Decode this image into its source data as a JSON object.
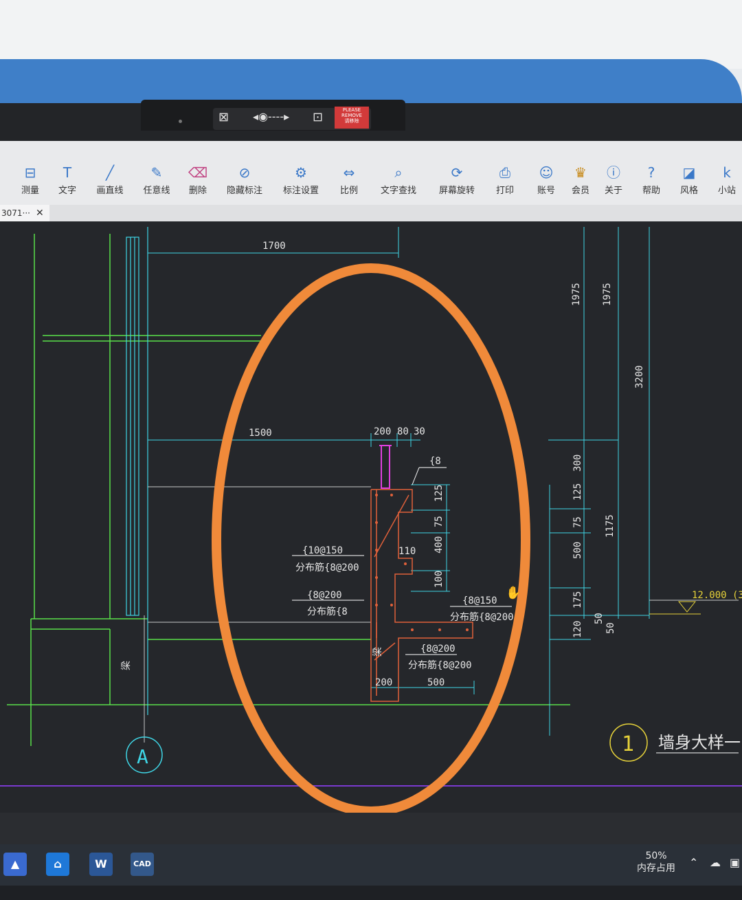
{
  "camera_cover": {
    "please_line1": "PLEASE",
    "please_line2": "REMOVE",
    "please_line3": "请移除"
  },
  "toolbar": {
    "items": [
      {
        "label": "测量",
        "icon": "measure-icon"
      },
      {
        "label": "文字",
        "icon": "text-icon"
      },
      {
        "label": "画直线",
        "icon": "line-icon"
      },
      {
        "label": "任意线",
        "icon": "pencil-icon"
      },
      {
        "label": "删除",
        "icon": "eraser-icon"
      },
      {
        "label": "隐藏标注",
        "icon": "hide-eye-icon"
      },
      {
        "label": "标注设置",
        "icon": "annotation-settings-icon"
      },
      {
        "label": "比例",
        "icon": "scale-icon"
      },
      {
        "label": "文字查找",
        "icon": "text-search-icon"
      },
      {
        "label": "屏幕旋转",
        "icon": "rotate-screen-icon"
      },
      {
        "label": "打印",
        "icon": "printer-icon"
      },
      {
        "label": "账号",
        "icon": "account-icon"
      },
      {
        "label": "会员",
        "icon": "vip-icon"
      },
      {
        "label": "关于",
        "icon": "info-icon"
      },
      {
        "label": "帮助",
        "icon": "help-icon"
      },
      {
        "label": "风格",
        "icon": "style-icon"
      },
      {
        "label": "小站",
        "icon": "site-icon"
      }
    ]
  },
  "tab": {
    "label": "3071···",
    "close": "✕"
  },
  "drawing": {
    "dims": {
      "d1700": "1700",
      "d1500": "1500",
      "d200a": "200",
      "d80": "80",
      "d30": "30",
      "d1975a": "1975",
      "d1975b": "1975",
      "d3200": "3200",
      "d300": "300",
      "d125a": "125",
      "d75a": "75",
      "d500a": "500",
      "d175": "175",
      "d120": "120",
      "d50a": "50",
      "d50b": "50",
      "d1175": "1175",
      "d125b": "125",
      "d75b": "75",
      "d400": "400",
      "d100": "100",
      "d110": "110",
      "d200b": "200",
      "d500b": "500",
      "elev": "12.000",
      "elev_partial": "(3"
    },
    "notes": {
      "n_top": "{8",
      "n1a": "{10@150",
      "n1b": "分布筋{8@200",
      "n2a": "{8@200",
      "n2b": "分布筋{8",
      "n3a": "{8@150",
      "n3b": "分布筋{8@200",
      "n4a": "{8@200",
      "n4b": "分布筋{8@200",
      "beam": "梁"
    },
    "axis_label": "A",
    "detail_number": "1",
    "detail_title": "墙身大样一"
  },
  "status": {
    "memory_percent": "50%",
    "memory_label": "内存占用"
  },
  "taskbar": {
    "word_label": "W",
    "cad_label": "CAD"
  },
  "colors": {
    "highlight": "#f08a3a",
    "dim": "#3fd6e6",
    "wall": "#5ae04a",
    "rebar": "#e0603a",
    "magenta": "#e040e0",
    "yellow": "#e6d23a"
  }
}
